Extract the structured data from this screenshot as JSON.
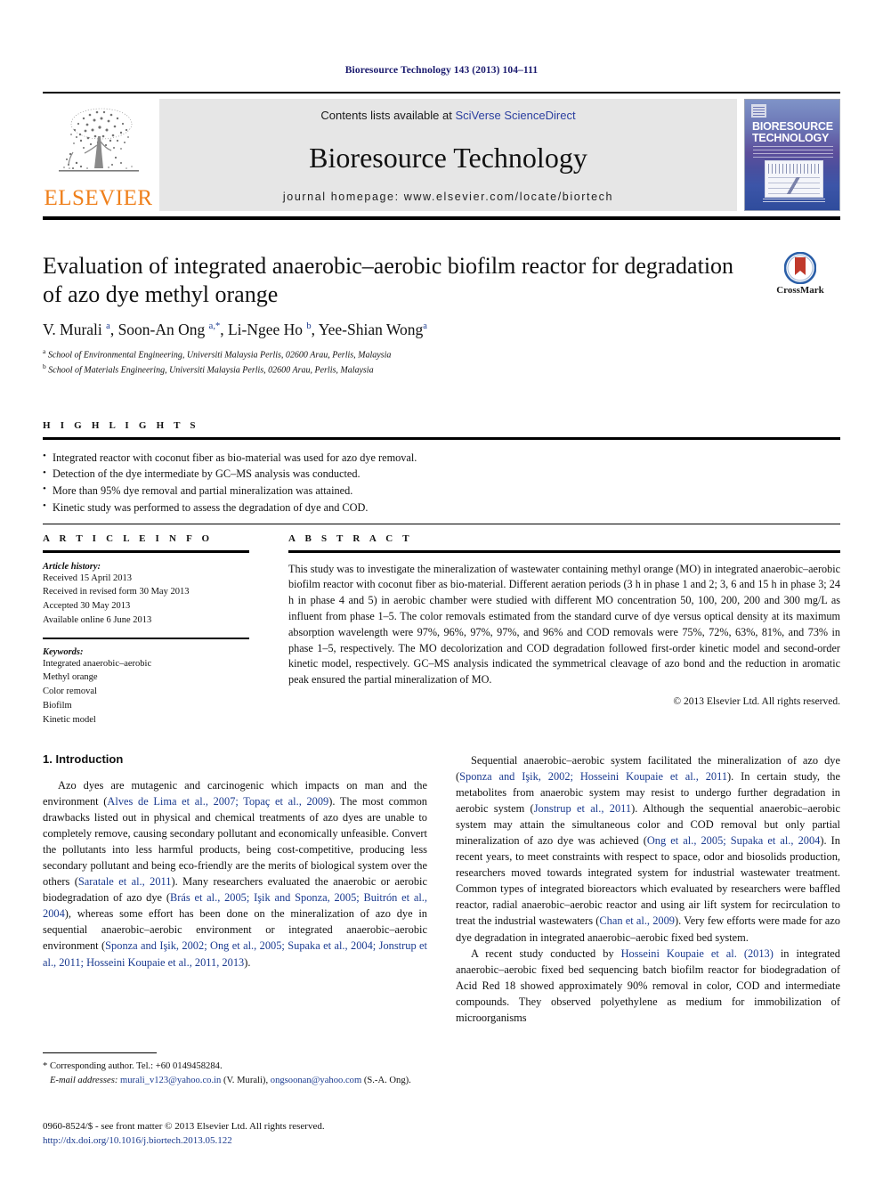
{
  "running_head": "Bioresource Technology 143 (2013) 104–111",
  "masthead": {
    "publisher_name": "ELSEVIER",
    "contents_prefix": "Contents lists available at ",
    "contents_link": "SciVerse ScienceDirect",
    "journal_name": "Bioresource Technology",
    "homepage": "journal homepage: www.elsevier.com/locate/biortech",
    "cover_title": "BIORESOURCE TECHNOLOGY"
  },
  "article": {
    "title": "Evaluation of integrated anaerobic–aerobic biofilm reactor for degradation of azo dye methyl orange",
    "authors_html": "V. Murali <sup>a</sup>, Soon-An Ong <sup>a,*</sup>, Li-Ngee Ho <sup>b</sup>, Yee-Shian Wong<sup>a</sup>",
    "affiliations": [
      {
        "mark": "a",
        "text": "School of Environmental Engineering, Universiti Malaysia Perlis, 02600 Arau, Perlis, Malaysia"
      },
      {
        "mark": "b",
        "text": "School of Materials Engineering, Universiti Malaysia Perlis, 02600 Arau, Perlis, Malaysia"
      }
    ],
    "crossmark_label": "CrossMark"
  },
  "highlights": {
    "heading": "H I G H L I G H T S",
    "items": [
      "Integrated reactor with coconut fiber as bio-material was used for azo dye removal.",
      "Detection of the dye intermediate by GC–MS analysis was conducted.",
      "More than 95% dye removal and partial mineralization was attained.",
      "Kinetic study was performed to assess the degradation of dye and COD."
    ]
  },
  "article_info": {
    "heading": "A R T I C L E    I N F O",
    "history_label": "Article history:",
    "history": [
      "Received 15 April 2013",
      "Received in revised form 30 May 2013",
      "Accepted 30 May 2013",
      "Available online 6 June 2013"
    ],
    "keywords_label": "Keywords:",
    "keywords": [
      "Integrated anaerobic–aerobic",
      "Methyl orange",
      "Color removal",
      "Biofilm",
      "Kinetic model"
    ]
  },
  "abstract": {
    "heading": "A B S T R A C T",
    "text": "This study was to investigate the mineralization of wastewater containing methyl orange (MO) in integrated anaerobic–aerobic biofilm reactor with coconut fiber as bio-material. Different aeration periods (3 h in phase 1 and 2; 3, 6 and 15 h in phase 3; 24 h in phase 4 and 5) in aerobic chamber were studied with different MO concentration 50, 100, 200, 200 and 300 mg/L as influent from phase 1–5. The color removals estimated from the standard curve of dye versus optical density at its maximum absorption wavelength were 97%, 96%, 97%, 97%, and 96% and COD removals were 75%, 72%, 63%, 81%, and 73% in phase 1–5, respectively. The MO decolorization and COD degradation followed first-order kinetic model and second-order kinetic model, respectively. GC–MS analysis indicated the symmetrical cleavage of azo bond and the reduction in aromatic peak ensured the partial mineralization of MO.",
    "copyright": "© 2013 Elsevier Ltd. All rights reserved."
  },
  "introduction": {
    "section_title": "1. Introduction",
    "left_paragraphs": [
      "Azo dyes are mutagenic and carcinogenic which impacts on man and the environment (<span class=\"cite\">Alves de Lima et al., 2007; Topaç et al., 2009</span>). The most common drawbacks listed out in physical and chemical treatments of azo dyes are unable to completely remove, causing secondary pollutant and economically unfeasible. Convert the pollutants into less harmful products, being cost-competitive, producing less secondary pollutant and being eco-friendly are the merits of biological system over the others (<span class=\"cite\">Saratale et al., 2011</span>). Many researchers evaluated the anaerobic or aerobic biodegradation of azo dye (<span class=\"cite\">Brás et al., 2005; Işik and Sponza, 2005; Buitrón et al., 2004</span>), whereas some effort has been done on the mineralization of azo dye in sequential anaerobic–aerobic environment or integrated anaerobic–aerobic environment (<span class=\"cite\">Sponza and Işik, 2002; Ong et al., 2005; Supaka et al., 2004; Jonstrup et al., 2011; Hosseini Koupaie et al., 2011, 2013</span>)."
    ],
    "right_paragraphs": [
      "Sequential anaerobic–aerobic system facilitated the mineralization of azo dye (<span class=\"cite\">Sponza and Işik, 2002; Hosseini Koupaie et al., 2011</span>). In certain study, the metabolites from anaerobic system may resist to undergo further degradation in aerobic system (<span class=\"cite\">Jonstrup et al., 2011</span>). Although the sequential anaerobic–aerobic system may attain the simultaneous color and COD removal but only partial mineralization of azo dye was achieved (<span class=\"cite\">Ong et al., 2005; Supaka et al., 2004</span>). In recent years, to meet constraints with respect to space, odor and biosolids production, researchers moved towards integrated system for industrial wastewater treatment. Common types of integrated bioreactors which evaluated by researchers were baffled reactor, radial anaerobic–aerobic reactor and using air lift system for recirculation to treat the industrial wastewaters (<span class=\"cite\">Chan et al., 2009</span>). Very few efforts were made for azo dye degradation in integrated anaerobic–aerobic fixed bed system.",
      "A recent study conducted by <span class=\"cite\">Hosseini Koupaie et al. (2013)</span> in integrated anaerobic–aerobic fixed bed sequencing batch biofilm reactor for biodegradation of Acid Red 18 showed approximately 90% removal in color, COD and intermediate compounds. They observed polyethylene as medium for immobilization of microorganisms"
    ]
  },
  "footnotes": {
    "corresponding": "* Corresponding author. Tel.: +60 0149458284.",
    "email_label": "E-mail addresses:",
    "email_html": "<span class=\"mail\">murali_v123@yahoo.co.in</span> (V. Murali), <span class=\"mail\">ongsoonan@yahoo.com</span> (S.-A. Ong)."
  },
  "footer": {
    "issn": "0960-8524/$ - see front matter © 2013 Elsevier Ltd. All rights reserved.",
    "doi": "http://dx.doi.org/10.1016/j.biortech.2013.05.122"
  },
  "colors": {
    "link_blue": "#2b3fa0",
    "cite_blue": "#1a3a8f",
    "running_head_navy": "#1a1a6e",
    "elsevier_orange": "#ef7f1a",
    "crossmark_blue": "#2b5fa8",
    "crossmark_red": "#c0392b"
  }
}
